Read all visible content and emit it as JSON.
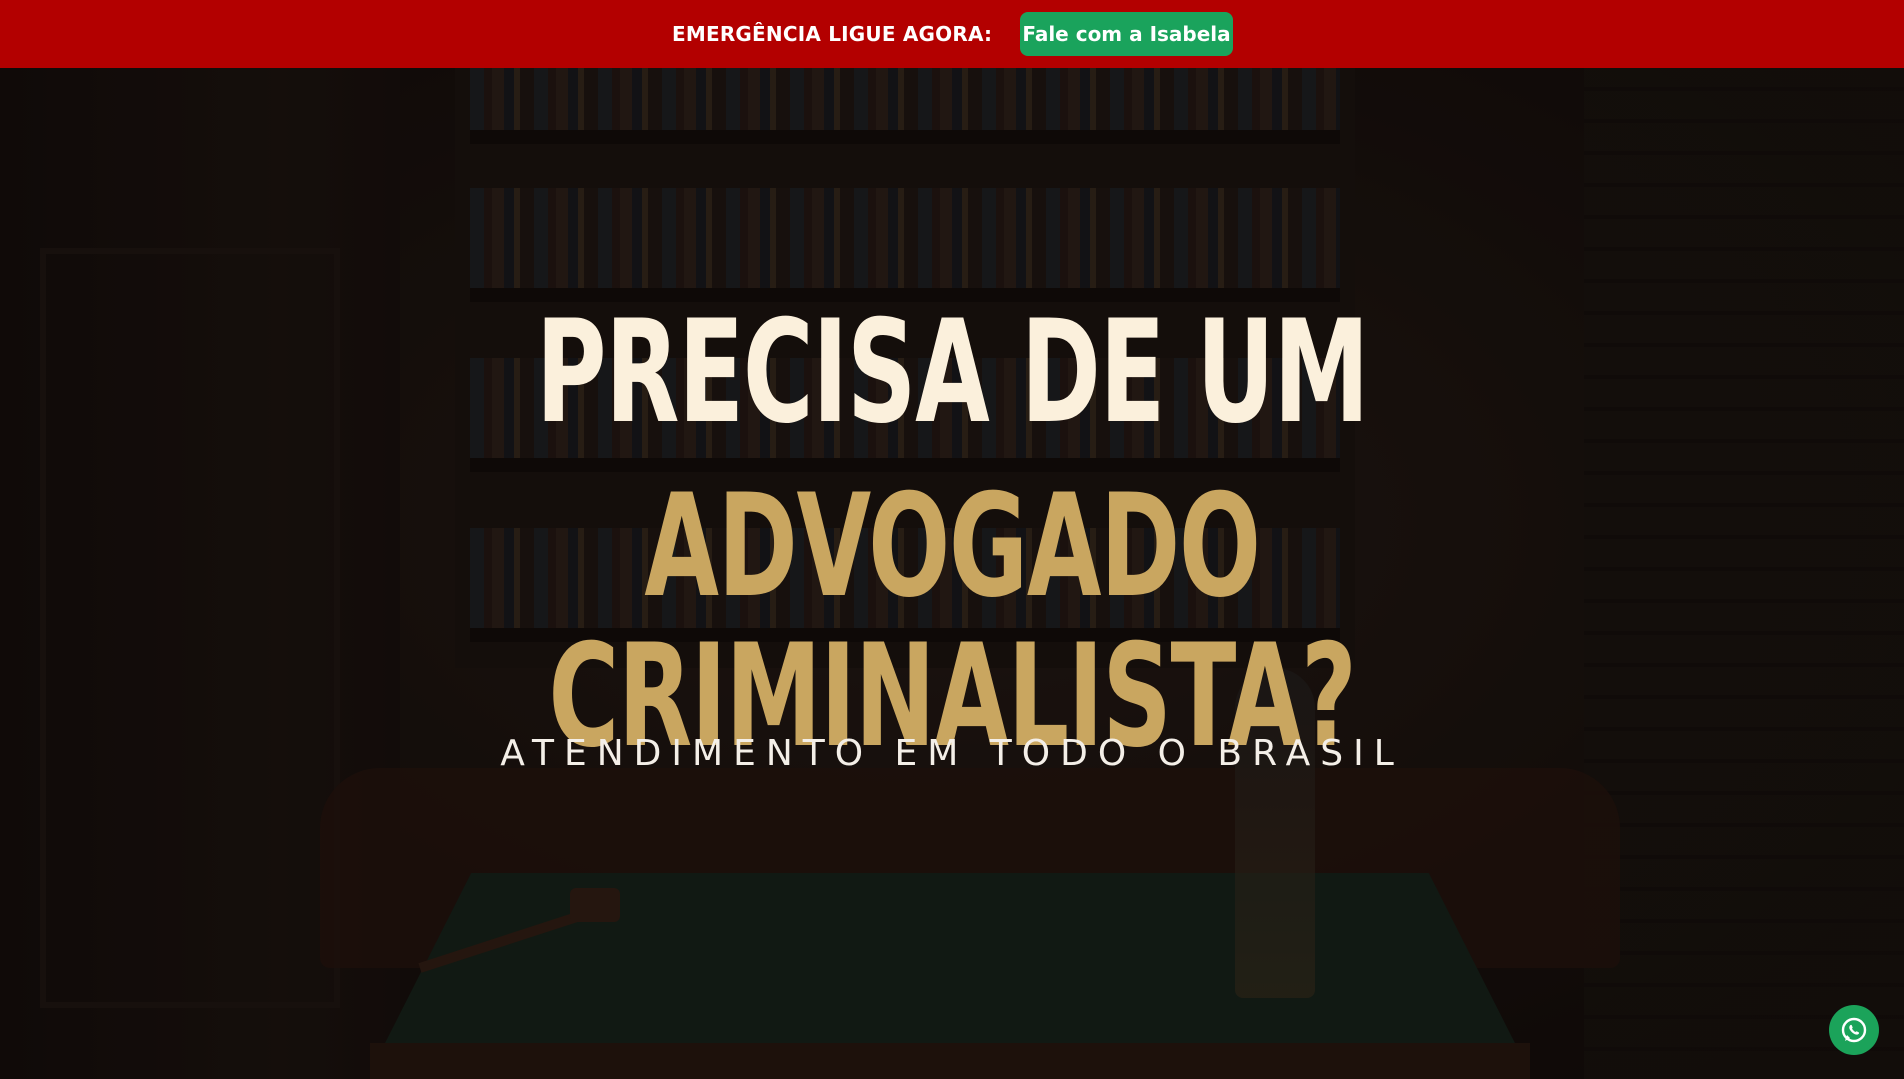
{
  "topbar": {
    "label": "EMERGÊNCIA LIGUE AGORA:",
    "cta_label": "Fale com a Isabela",
    "background_color": "#b30000",
    "cta_color": "#1aa35c"
  },
  "hero": {
    "headline_line1": "Precisa de um",
    "headline_line2": "Advogado Criminalista?",
    "subtitle": "ATENDIMENTO EM TODO O BRASIL",
    "headline_line1_color": "#fbf0dc",
    "headline_line2_color": "#c9a660"
  },
  "floating": {
    "whatsapp_icon": "whatsapp-icon",
    "whatsapp_color": "#1ba35a"
  }
}
